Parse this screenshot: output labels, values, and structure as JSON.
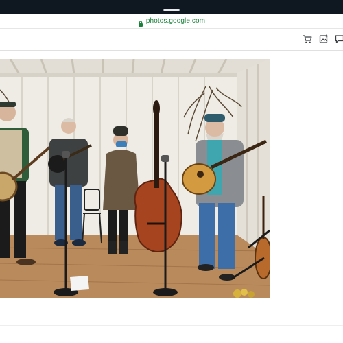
{
  "browser": {
    "url": "photos.google.com"
  },
  "toolbar": {
    "icons": [
      "cart-icon",
      "add-to-album-icon",
      "comment-icon"
    ]
  },
  "photo": {
    "subject": "Five-piece bluegrass band in a small white shed"
  },
  "colors": {
    "status_bar": "#0f1821",
    "url_green": "#188038",
    "floor": "#b98a5c",
    "wall": "#efece6"
  }
}
